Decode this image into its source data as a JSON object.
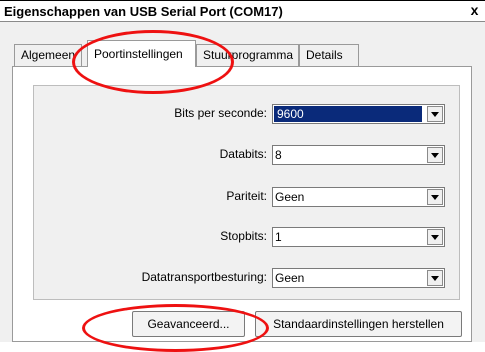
{
  "window": {
    "title": "Eigenschappen van USB Serial Port (COM17)",
    "close_label": "x"
  },
  "tabs": [
    {
      "label": "Algemeen",
      "active": false
    },
    {
      "label": "Poortinstellingen",
      "active": true
    },
    {
      "label": "Stuurprogramma",
      "active": false
    },
    {
      "label": "Details",
      "active": false
    }
  ],
  "settings": [
    {
      "label": "Bits per seconde:",
      "value": "9600"
    },
    {
      "label": "Databits:",
      "value": "8"
    },
    {
      "label": "Pariteit:",
      "value": "Geen"
    },
    {
      "label": "Stopbits:",
      "value": "1"
    },
    {
      "label": "Datatransportbesturing:",
      "value": "Geen"
    }
  ],
  "buttons": {
    "advanced": "Geavanceerd...",
    "restore_defaults": "Standaardinstellingen herstellen"
  },
  "colors": {
    "annotation": "#ee1111",
    "selection": "#0a2a7a"
  }
}
